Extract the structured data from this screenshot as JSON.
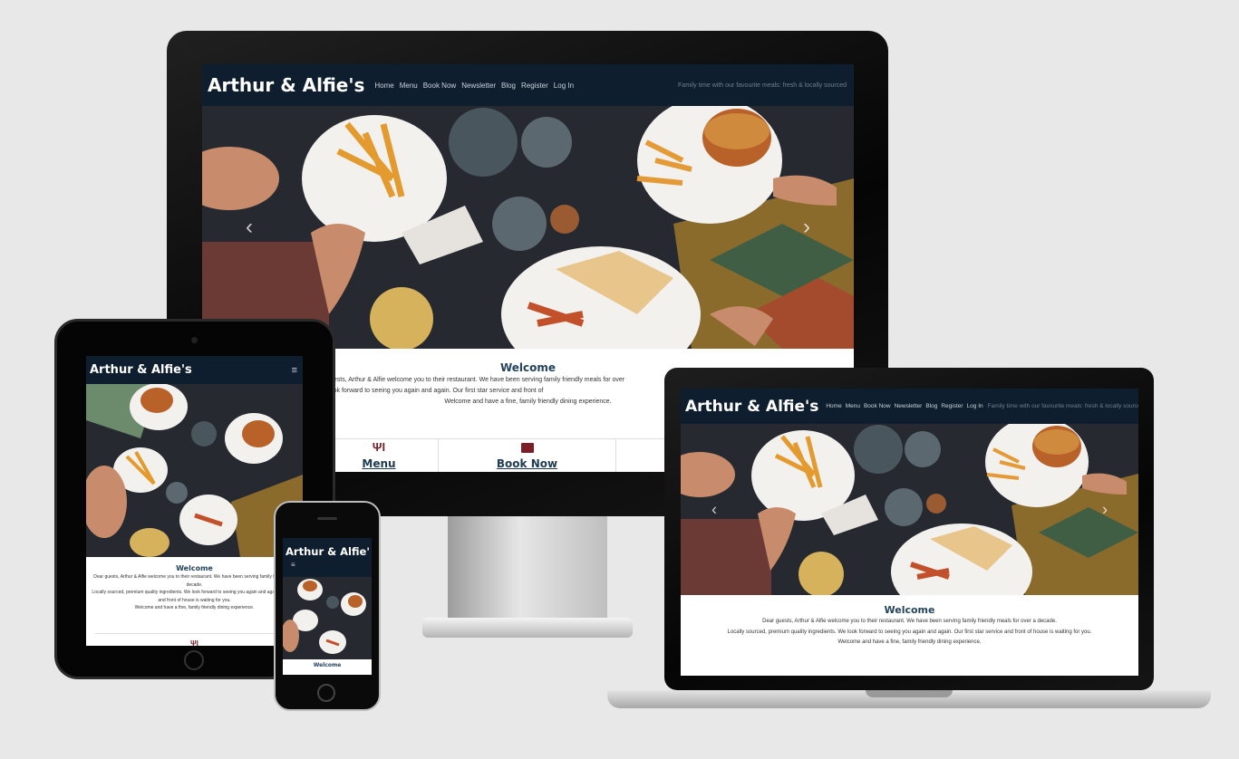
{
  "site": {
    "brand": "Arthur & Alfie's",
    "brand_mobile": "Arthur & Alfie'",
    "nav": [
      "Home",
      "Menu",
      "Book Now",
      "Newsletter",
      "Blog",
      "Register",
      "Log In"
    ],
    "tagline": "Family time with our favourite meals: fresh & locally sourced",
    "welcome_title": "Welcome",
    "welcome_line1": "Dear guests, Arthur & Alfie welcome you to their restaurant. We have been serving family friendly meals for over a decade.",
    "welcome_line2": "Locally sourced, premium quality ingredients. We look forward to seeing you again and again. Our first star service and front of house is waiting for you.",
    "welcome_line3": "Welcome and have a fine, family friendly dining experience.",
    "desktop_line1": "Dear guests, Arthur & Alfie welcome you to their restaurant. We have been serving family friendly meals for over",
    "desktop_line2": "lly sourced, premium quality ingredients. We look forward to seeing you again and again. Our first star service and front of",
    "tablet_line1": "Dear guests, Arthur & Alfie welcome you to their restaurant. We have been serving family friendly me",
    "tablet_line1b": "decade.",
    "tablet_line2": "Locally sourced, premium quality ingredients. We look forward to seeing you again and again. Our first",
    "tablet_line2b": "and front of house is waiting for you.",
    "cards": [
      {
        "label": "Menu",
        "icon": "utensils-icon"
      },
      {
        "label": "Book Now",
        "icon": "book-icon"
      }
    ],
    "hamburger": "≡",
    "carousel_prev": "‹",
    "carousel_next": "›"
  },
  "colors": {
    "nav_bg": "#0f1e2e",
    "heading": "#24445e",
    "card_icon": "#7a1f28",
    "card_link": "#1f3a52"
  }
}
